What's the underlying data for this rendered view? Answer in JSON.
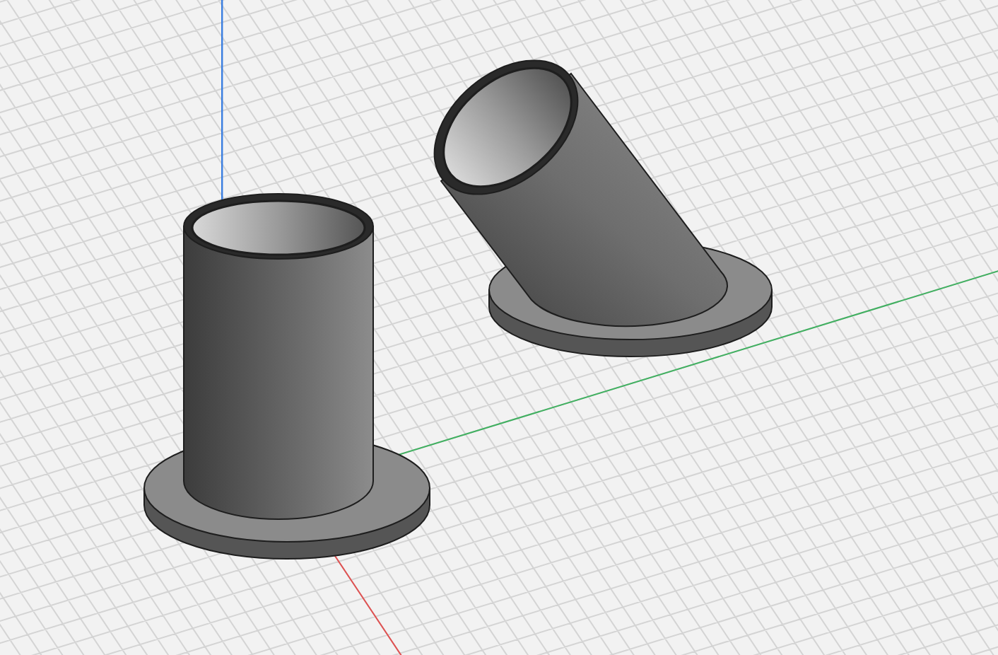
{
  "viewport": {
    "grid": true,
    "axes": [
      {
        "kind": "x",
        "color": "#e05050"
      },
      {
        "kind": "y",
        "color": "#40b060"
      },
      {
        "kind": "z",
        "color": "#3a7ee0"
      }
    ]
  }
}
